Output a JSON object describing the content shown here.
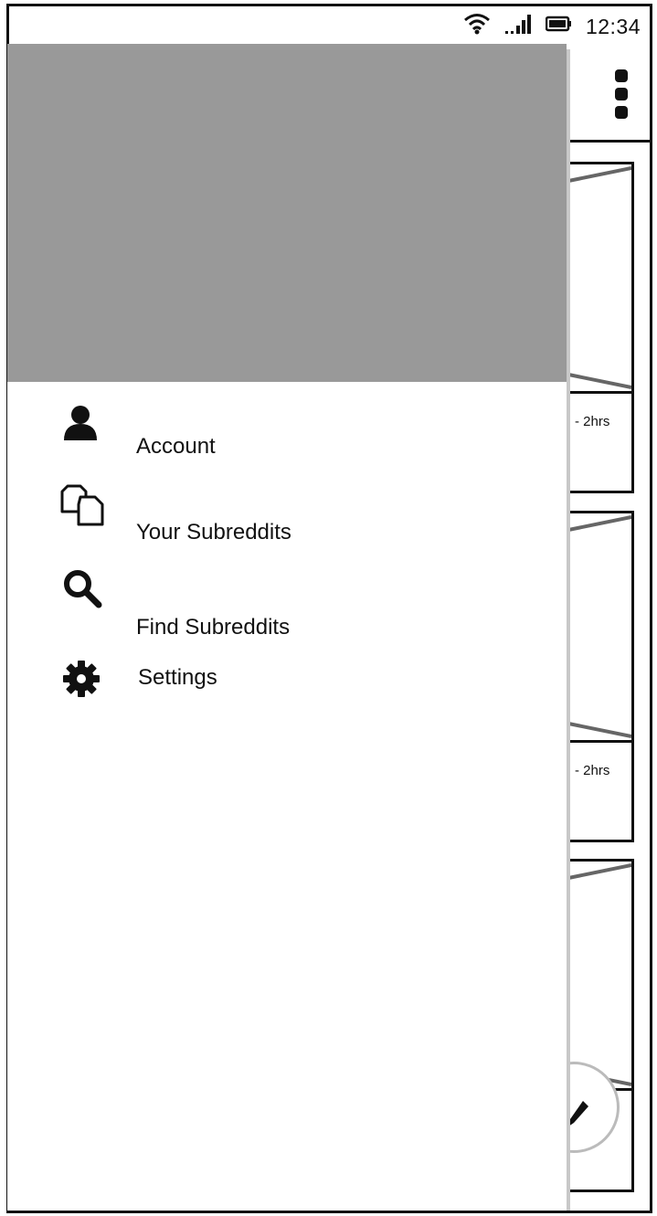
{
  "status_bar": {
    "time": "12:34",
    "wifi_icon": "wifi-icon",
    "signal_icon": "signal-icon",
    "battery_icon": "battery-icon"
  },
  "toolbar": {
    "overflow_icon": "overflow-menu-icon"
  },
  "posts": [
    {
      "time": "- 2hrs"
    },
    {
      "time": "- 2hrs"
    },
    {
      "time": ""
    }
  ],
  "fab": {
    "icon": "pencil-icon"
  },
  "drawer": {
    "items": [
      {
        "label": "Account",
        "icon": "person-icon"
      },
      {
        "label": "Your Subreddits",
        "icon": "copy-icon"
      },
      {
        "label": "Find Subreddits",
        "icon": "search-icon"
      },
      {
        "label": "Settings",
        "icon": "gear-icon"
      }
    ]
  },
  "colors": {
    "drawer_header": "#999999",
    "ink": "#111111",
    "scrim_edge": "#c8c8c8"
  }
}
